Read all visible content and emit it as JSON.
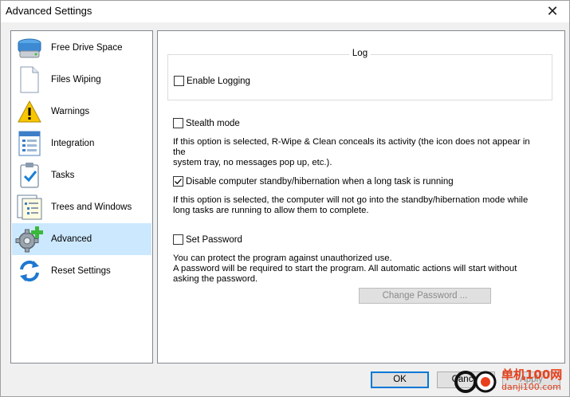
{
  "window": {
    "title": "Advanced Settings",
    "close_glyph": "✕"
  },
  "sidebar": {
    "items": [
      {
        "label": "Free Drive Space",
        "icon": "drive-icon"
      },
      {
        "label": "Files Wiping",
        "icon": "document-icon"
      },
      {
        "label": "Warnings",
        "icon": "warning-icon"
      },
      {
        "label": "Integration",
        "icon": "integration-icon"
      },
      {
        "label": "Tasks",
        "icon": "tasks-icon"
      },
      {
        "label": "Trees and Windows",
        "icon": "trees-icon"
      },
      {
        "label": "Advanced",
        "icon": "gear-plus-icon",
        "selected": true
      },
      {
        "label": "Reset Settings",
        "icon": "refresh-icon"
      }
    ]
  },
  "main": {
    "log_group_title": "Log",
    "enable_logging": {
      "label": "Enable Logging",
      "checked": false
    },
    "stealth_mode": {
      "label": "Stealth mode",
      "checked": false,
      "desc_line1": "If this option is selected, R-Wipe & Clean conceals its activity (the icon does not appear in the",
      "desc_line2": "system tray, no messages pop up, etc.)."
    },
    "disable_standby": {
      "label": "Disable computer standby/hibernation when a long task is running",
      "checked": true,
      "desc_line1": "If this option is selected, the computer will not go into the standby/hibernation mode while",
      "desc_line2": "long tasks are running to allow them to complete."
    },
    "set_password": {
      "label": "Set Password",
      "checked": false,
      "desc_line1": "You can protect the program against unauthorized use.",
      "desc_line2": "A password will be required to start the program. All automatic actions will start without",
      "desc_line3": "asking the password."
    },
    "change_password_label": "Change Password ..."
  },
  "buttons": {
    "ok": "OK",
    "cancel": "Cancel",
    "apply": "Apply"
  },
  "watermark": {
    "cn": "单机100网",
    "url": "danji100.com"
  },
  "colors": {
    "selection": "#cce8ff",
    "accent": "#0078d7",
    "watermark": "#e8401c"
  }
}
